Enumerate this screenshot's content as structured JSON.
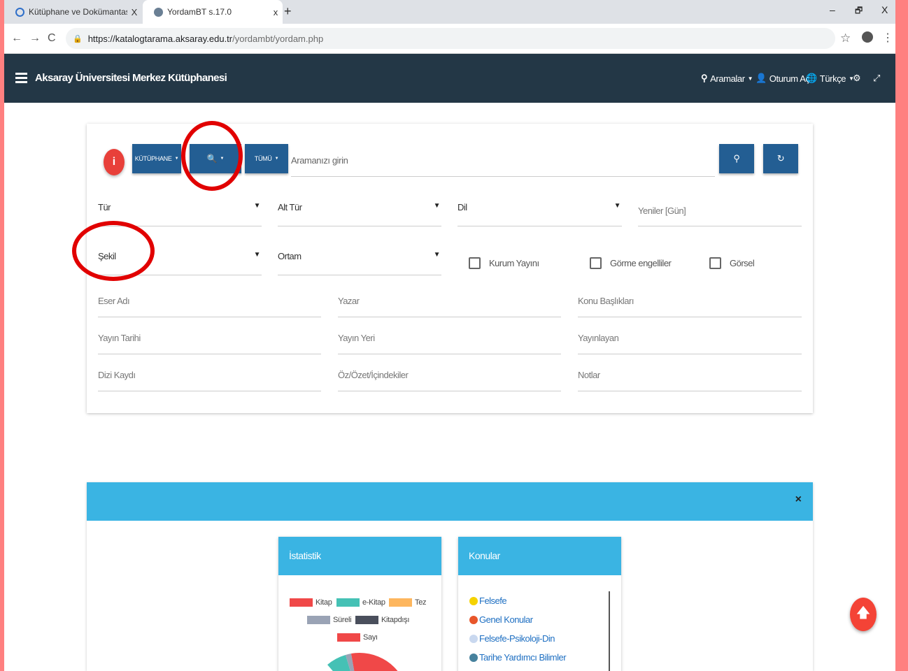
{
  "browser": {
    "tabs": [
      {
        "title": "Kütüphane ve Dokümantasyon D",
        "close": "X"
      },
      {
        "title": "YordamBT s.17.0",
        "close": "x"
      }
    ],
    "new_tab": "+",
    "window_controls": {
      "minimize": "–",
      "restore": "🗗",
      "close": "X"
    },
    "url_host": "https://katalogtarama.aksaray.edu.tr",
    "url_path": "/yordambt/yordam.php"
  },
  "navbar": {
    "brand": "Aksaray Üniversitesi Merkez Kütüphanesi",
    "searches": "Aramalar",
    "login": "Oturum Aç",
    "language": "Türkçe"
  },
  "search": {
    "info_label": "i",
    "library_button": "KÜTÜPHANE",
    "all_button": "TÜMÜ",
    "placeholder": "Aramanızı girin",
    "filters": {
      "tur": "Tür",
      "alt_tur": "Alt Tür",
      "dil": "Dil",
      "yeniler": "Yeniler [Gün]",
      "sekil": "Şekil",
      "ortam": "Ortam"
    },
    "checkboxes": [
      "Kurum Yayını",
      "Görme engelliler",
      "Görsel"
    ],
    "fields": [
      [
        "Eser Adı",
        "Yazar",
        "Konu Başlıkları"
      ],
      [
        "Yayın Tarihi",
        "Yayın Yeri",
        "Yayınlayan"
      ],
      [
        "Dizi Kaydı",
        "Öz/Özet/İçindekiler",
        "Notlar"
      ]
    ]
  },
  "panel": {
    "close": "×",
    "stats_title": "İstatistik",
    "topics_title": "Konular",
    "legend": [
      {
        "label": "Kitap",
        "color": "#f04848"
      },
      {
        "label": "e-Kitap",
        "color": "#45c1b5"
      },
      {
        "label": "Tez",
        "color": "#fdb65e"
      },
      {
        "label": "Süreli",
        "color": "#9aa3b5"
      },
      {
        "label": "Kitapdışı",
        "color": "#4a4f5c"
      },
      {
        "label": "Sayı",
        "color": "#f04848"
      }
    ],
    "topics": [
      {
        "label": "Felsefe",
        "color": "#f5d200"
      },
      {
        "label": "Genel Konular",
        "color": "#e8562a"
      },
      {
        "label": "Felsefe-Psikoloji-Din",
        "color": "#c9d8ef"
      },
      {
        "label": "Tarihe Yardımcı Bilimler",
        "color": "#46819d"
      }
    ]
  },
  "colors": {
    "navbar": "#233746",
    "button": "#235e93",
    "panel_header": "#3ab4e3",
    "accent": "#f44336"
  }
}
